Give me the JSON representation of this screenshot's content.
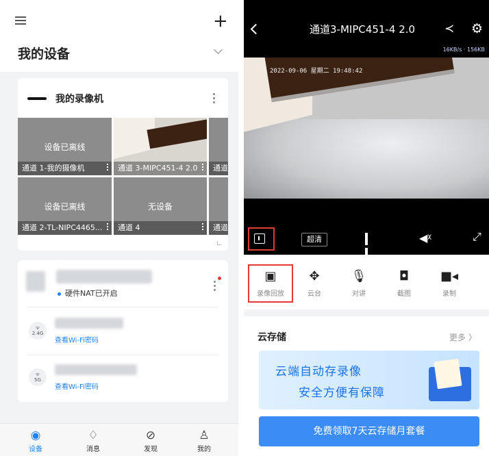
{
  "left": {
    "header": {
      "title": "我的设备"
    },
    "recorder": {
      "name": "我的录像机",
      "tiles": [
        {
          "status": "设备已离线",
          "caption": "通道 1-我的摄像机"
        },
        {
          "status": "",
          "caption": "通道 3-MIPC451-4 2.0"
        },
        {
          "status": "",
          "caption": "通道"
        },
        {
          "status": "设备已离线",
          "caption": "通道 2-TL-NIPC4465..."
        },
        {
          "status": "无设备",
          "caption": "通道 4"
        },
        {
          "status": "",
          "caption": "通道"
        }
      ]
    },
    "router": {
      "nat_status": "硬件NAT已开启",
      "wifi": [
        {
          "band": "2.4G",
          "link": "查看Wi-Fi密码"
        },
        {
          "band": "5G",
          "link": "查看Wi-Fi密码"
        }
      ]
    },
    "tabs": [
      {
        "label": "设备",
        "icon": "target-icon"
      },
      {
        "label": "消息",
        "icon": "bell-icon"
      },
      {
        "label": "发现",
        "icon": "compass-icon"
      },
      {
        "label": "我的",
        "icon": "person-icon"
      }
    ]
  },
  "right": {
    "title": "通道3-MIPC451-4 2.0",
    "speed": "16KB/s · 156KB",
    "osd_time": "2022-09-06 星期二 19:48:42",
    "quality": "超清",
    "tools": [
      {
        "label": "录像回放",
        "icon": "playback-icon"
      },
      {
        "label": "云台",
        "icon": "ptz-icon"
      },
      {
        "label": "对讲",
        "icon": "mic-icon"
      },
      {
        "label": "截图",
        "icon": "camera-icon"
      },
      {
        "label": "录制",
        "icon": "record-icon"
      }
    ],
    "cloud": {
      "title": "云存储",
      "more": "更多 〉",
      "banner_line1": "云端自动存录像",
      "banner_line2": "安全方便有保障",
      "cta": "免费领取7天云存储月套餐"
    }
  },
  "colors": {
    "accent": "#1e82f0",
    "highlight": "#e53935",
    "cta": "#3c8cf5"
  }
}
